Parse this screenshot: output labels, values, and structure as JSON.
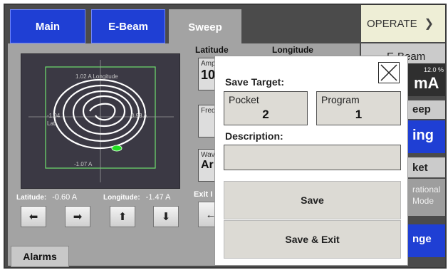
{
  "tabs": [
    {
      "label": "Main"
    },
    {
      "label": "E-Beam"
    },
    {
      "label": "Sweep"
    }
  ],
  "operate": {
    "label": "OPERATE"
  },
  "columns": {
    "latitude": "Latitude",
    "longitude": "Longitude"
  },
  "scope": {
    "top_label": "1.02 A  Longitude",
    "left_label": "-1.04",
    "left_sub": "Lati",
    "right_label": "0.98 A",
    "bottom_label": "-1.07 A"
  },
  "readouts": {
    "latitude_label": "Latitude:",
    "latitude_value": "-0.60 A",
    "longitude_label": "Longitude:",
    "longitude_value": "-1.47 A"
  },
  "partial": {
    "amp_label": "Amp",
    "amp_value": "10",
    "freq_label": "Freq",
    "wave_label": "Wav",
    "wave_value": "Ar",
    "exit_label": "Exit I"
  },
  "right_panel": {
    "ebeam": "E-Beam",
    "percent": "12.0 %",
    "unit": "mA",
    "sweep": "eep",
    "sweep_state": "ing",
    "pocket": "ket",
    "mode1": "rational",
    "mode2": "Mode",
    "change": "nge"
  },
  "alarms": {
    "label": "Alarms"
  },
  "dialog": {
    "title": "Save Target:",
    "pocket_label": "Pocket",
    "pocket_value": "2",
    "program_label": "Program",
    "program_value": "1",
    "description_label": "Description:",
    "description_value": "",
    "save_label": "Save",
    "save_exit_label": "Save & Exit"
  },
  "colors": {
    "tab_active": "#1f3fd4",
    "tab_selected": "#a3a3a3",
    "operate_bg": "#eeeed6",
    "trace": "#ffffff",
    "beam": "#22dd22"
  }
}
